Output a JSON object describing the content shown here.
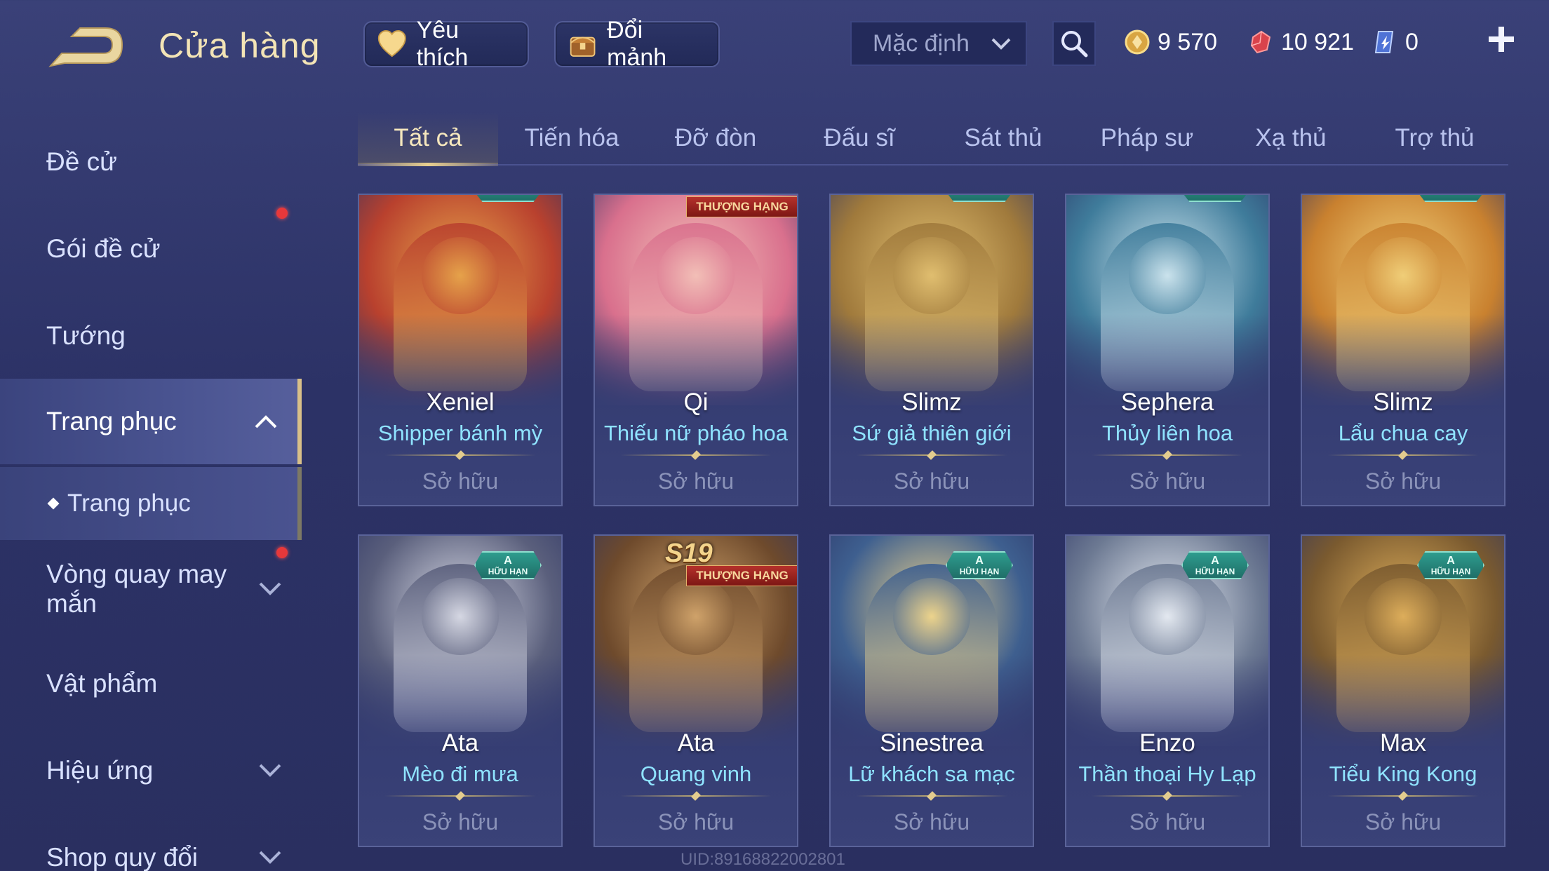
{
  "header": {
    "title": "Cửa hàng",
    "favorites_label": "Yêu thích",
    "exchange_label": "Đổi mảnh",
    "sort_value": "Mặc định",
    "currencies": {
      "gold": "9 570",
      "ruby": "10 921",
      "voucher": "0"
    }
  },
  "sidebar": {
    "items": [
      {
        "label": "Đề cử"
      },
      {
        "label": "Gói đề cử"
      },
      {
        "label": "Tướng"
      },
      {
        "label": "Trang phục"
      },
      {
        "label": "Trang phục"
      },
      {
        "label": "Vòng quay may mắn"
      },
      {
        "label": "Vật phẩm"
      },
      {
        "label": "Hiệu ứng"
      },
      {
        "label": "Shop quy đổi"
      }
    ]
  },
  "tabs": [
    "Tất cả",
    "Tiến hóa",
    "Đỡ đòn",
    "Đấu sĩ",
    "Sát thủ",
    "Pháp sư",
    "Xạ thủ",
    "Trợ thủ"
  ],
  "badges": {
    "limited_tier": "A",
    "limited_text": "HỮU HẠN",
    "premium_text": "THƯỢNG HẠNG",
    "season": "S19"
  },
  "cards": [
    {
      "hero": "Xeniel",
      "skin": "Shipper bánh mỳ",
      "status": "Sở hữu",
      "colors": [
        "#b9412e",
        "#e7a54b"
      ]
    },
    {
      "hero": "Qi",
      "skin": "Thiếu nữ pháo hoa",
      "status": "Sở hữu",
      "colors": [
        "#d9708d",
        "#f3c1b8"
      ]
    },
    {
      "hero": "Slimz",
      "skin": "Sứ giả thiên giới",
      "status": "Sở hữu",
      "colors": [
        "#a07a3c",
        "#e2c071"
      ]
    },
    {
      "hero": "Sephera",
      "skin": "Thủy liên hoa",
      "status": "Sở hữu",
      "colors": [
        "#3f7c9b",
        "#cfe6ef"
      ]
    },
    {
      "hero": "Slimz",
      "skin": "Lẩu chua cay",
      "status": "Sở hữu",
      "colors": [
        "#c9812f",
        "#f1d07a"
      ]
    },
    {
      "hero": "Ata",
      "skin": "Mèo đi mưa",
      "status": "Sở hữu",
      "colors": [
        "#5a5f7c",
        "#d9dbe6"
      ]
    },
    {
      "hero": "Ata",
      "skin": "Quang vinh",
      "status": "Sở hữu",
      "colors": [
        "#6e4a2c",
        "#d2a56c"
      ]
    },
    {
      "hero": "Sinestrea",
      "skin": "Lữ khách sa mạc",
      "status": "Sở hữu",
      "colors": [
        "#3e5f8f",
        "#f2d78c"
      ]
    },
    {
      "hero": "Enzo",
      "skin": "Thần thoại Hy Lạp",
      "status": "Sở hữu",
      "colors": [
        "#6d7a93",
        "#e7ecf3"
      ]
    },
    {
      "hero": "Max",
      "skin": "Tiểu King Kong",
      "status": "Sở hữu",
      "colors": [
        "#7a5a2f",
        "#e0b05c"
      ]
    }
  ],
  "watermark": "UID:891688220028​01",
  "colors": {
    "accent_gold": "#e8cf8f",
    "skin_name": "#8fe3ff",
    "notification": "#e8383a"
  },
  "icons": [
    "back-arrow-icon",
    "heart-icon",
    "chest-icon",
    "chevron-down-icon",
    "search-icon",
    "gold-coin-icon",
    "ruby-icon",
    "voucher-icon",
    "plus-icon",
    "chevron-up-icon"
  ]
}
